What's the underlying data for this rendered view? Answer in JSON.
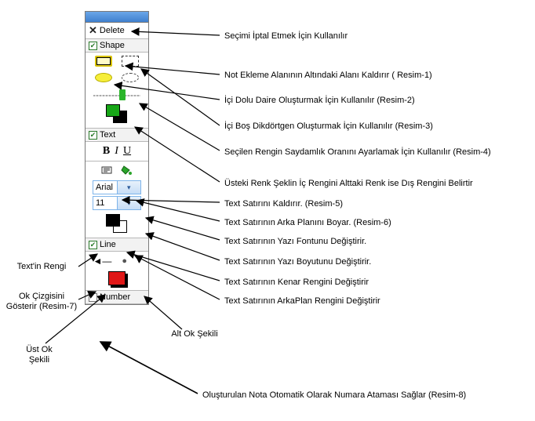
{
  "panel": {
    "delete_label": "Delete",
    "shape_label": "Shape",
    "text_label": "Text",
    "line_label": "Line",
    "number_label": "Number",
    "font_name": "Arial",
    "font_size": "11",
    "biu": {
      "b": "B",
      "i": "I",
      "u": "U"
    }
  },
  "callouts": {
    "c1": "Seçimi İptal Etmek İçin Kullanılır",
    "c2": "Not Ekleme Alanının Altındaki Alanı Kaldırır ( Resim-1)",
    "c3": "İçi Dolu Daire Oluşturmak İçin Kullanılır (Resim-2)",
    "c4": "İçi Boş  Dikdörtgen Oluşturmak İçin Kullanılır (Resim-3)",
    "c5": "Seçilen Rengin Saydamlık Oranını Ayarlamak İçin Kullanılır (Resim-4)",
    "c6": "Üsteki Renk Şeklin İç Rengini Alttaki Renk ise Dış Rengini Belirtir",
    "c7": "Text Satırını Kaldırır. (Resim-5)",
    "c8": "Text Satırının Arka Planını Boyar. (Resim-6)",
    "c9": "Text Satırının Yazı Fontunu Değiştirir.",
    "c10": "Text Satırının Yazı Boyutunu Değiştirir.",
    "c11": "Text Satırının Kenar Rengini Değiştirir",
    "c12": "Text Satırının ArkaPlan Rengini Değiştirir",
    "c13": "Oluşturulan Nota Otomatik Olarak Numara Ataması Sağlar (Resim-8)"
  },
  "left_labels": {
    "text_color": "Text'in Rengi",
    "line_arrow": "Ok Çizgisini Gösterir (Resim-7)",
    "top_arrow": "Üst Ok Şekili",
    "bottom_arrow": "Alt Ok Şekili"
  }
}
